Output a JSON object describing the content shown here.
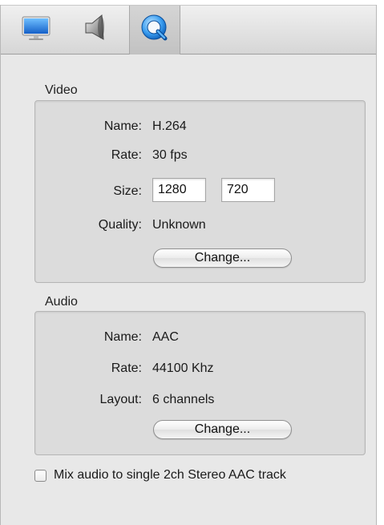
{
  "toolbar": {
    "tabs": [
      {
        "icon": "display-icon",
        "active": false
      },
      {
        "icon": "speaker-icon",
        "active": false
      },
      {
        "icon": "quicktime-icon",
        "active": true
      }
    ]
  },
  "video": {
    "section_label": "Video",
    "name_label": "Name:",
    "name_value": "H.264",
    "rate_label": "Rate:",
    "rate_value": "30 fps",
    "size_label": "Size:",
    "width_value": "1280",
    "height_value": "720",
    "quality_label": "Quality:",
    "quality_value": "Unknown",
    "change_label": "Change..."
  },
  "audio": {
    "section_label": "Audio",
    "name_label": "Name:",
    "name_value": "AAC",
    "rate_label": "Rate:",
    "rate_value": "44100 Khz",
    "layout_label": "Layout:",
    "layout_value": "6 channels",
    "change_label": "Change..."
  },
  "mix_audio": {
    "label": "Mix audio to single 2ch Stereo AAC track",
    "checked": false
  },
  "colors": {
    "panel_bg": "#e8e8e8",
    "group_bg": "#dcdcdc",
    "accent_blue": "#2f8fe0"
  }
}
